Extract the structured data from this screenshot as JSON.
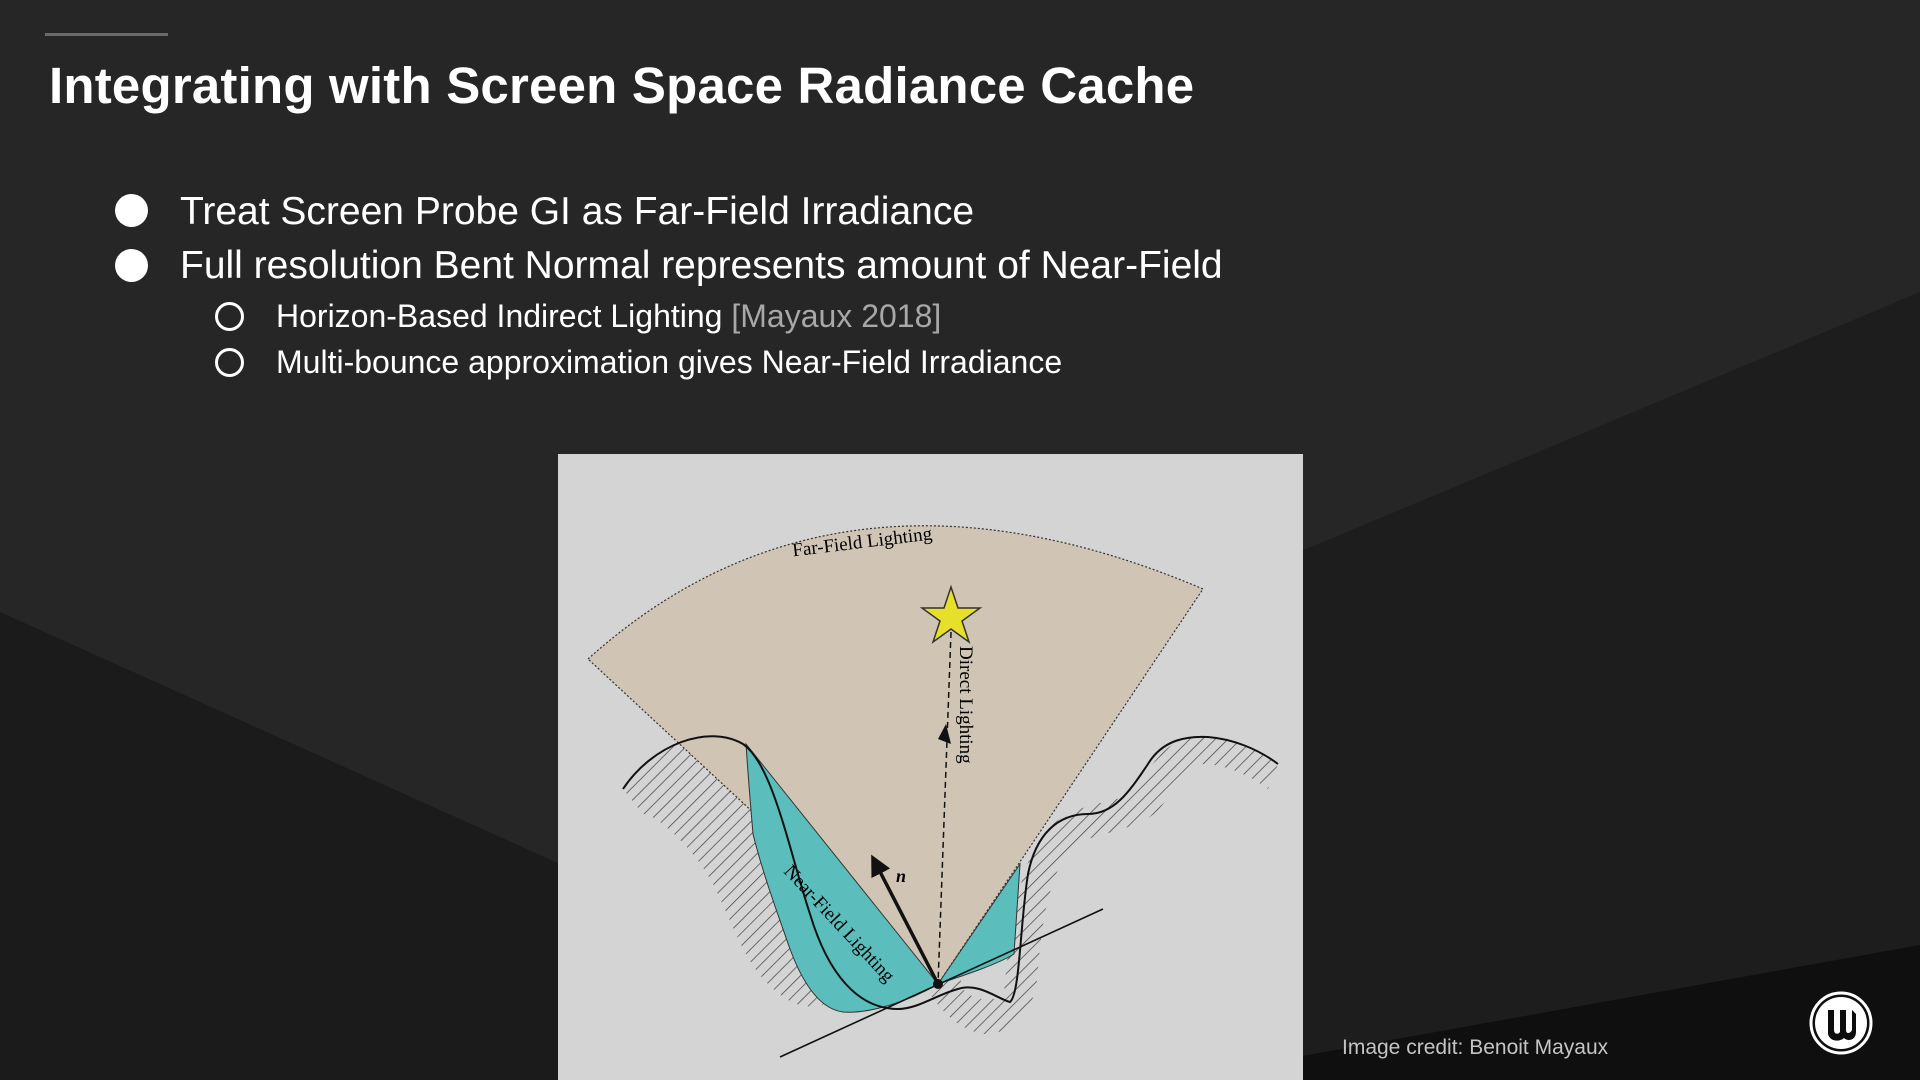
{
  "slide": {
    "title": "Integrating with Screen Space Radiance Cache",
    "bullets": [
      {
        "text": "Treat Screen Probe GI as Far-Field Irradiance"
      },
      {
        "text": "Full resolution Bent Normal represents amount of Near-Field"
      }
    ],
    "sub_bullets": [
      {
        "text": "Horizon-Based Indirect Lighting",
        "citation": "[Mayaux 2018]"
      },
      {
        "text": "Multi-bounce approximation gives Near-Field Irradiance",
        "citation": ""
      }
    ],
    "credit": "Image credit: Benoit Mayaux"
  },
  "figure": {
    "labels": {
      "far_field": "Far-Field Lighting",
      "direct": "Direct Lighting",
      "near_field": "Near-Field Lighting",
      "normal": "n"
    },
    "colors": {
      "background": "#d4d4d4",
      "far_field_fill": "#d0c4b4",
      "near_field_fill": "#5cbdbd",
      "star": "#e6e02a"
    }
  },
  "logo": {
    "icon": "unreal-engine-logo"
  },
  "colors": {
    "slide_background": "#262626",
    "accent_line": "#6a6a6a",
    "text": "#ffffff",
    "citation_text": "#a8a8a8"
  }
}
